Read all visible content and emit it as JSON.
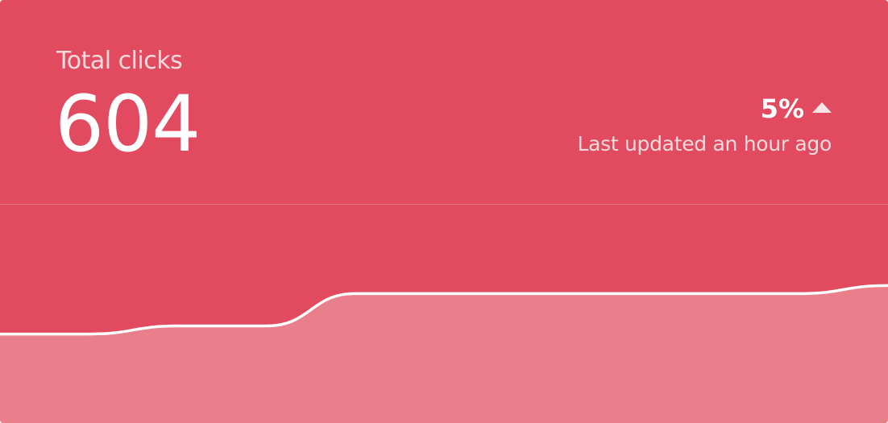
{
  "card": {
    "title": "Total clicks",
    "value": "604",
    "change": "5%",
    "change_direction_icon": "triangle-up-icon",
    "updated": "Last updated an hour ago"
  },
  "colors": {
    "background": "#e14a5f",
    "area_fill": "#ea7f8c",
    "line": "#ffffff"
  },
  "chart_data": {
    "type": "area",
    "title": "",
    "xlabel": "",
    "ylabel": "",
    "x": [
      0,
      1,
      2,
      3,
      4,
      5,
      6,
      7,
      8,
      9,
      10
    ],
    "series": [
      {
        "values": [
          0,
          0,
          2,
          2,
          10,
          10,
          10,
          10,
          10,
          10,
          12
        ]
      }
    ],
    "ylim": [
      -22,
      32
    ],
    "grid": false,
    "legend": "none"
  }
}
